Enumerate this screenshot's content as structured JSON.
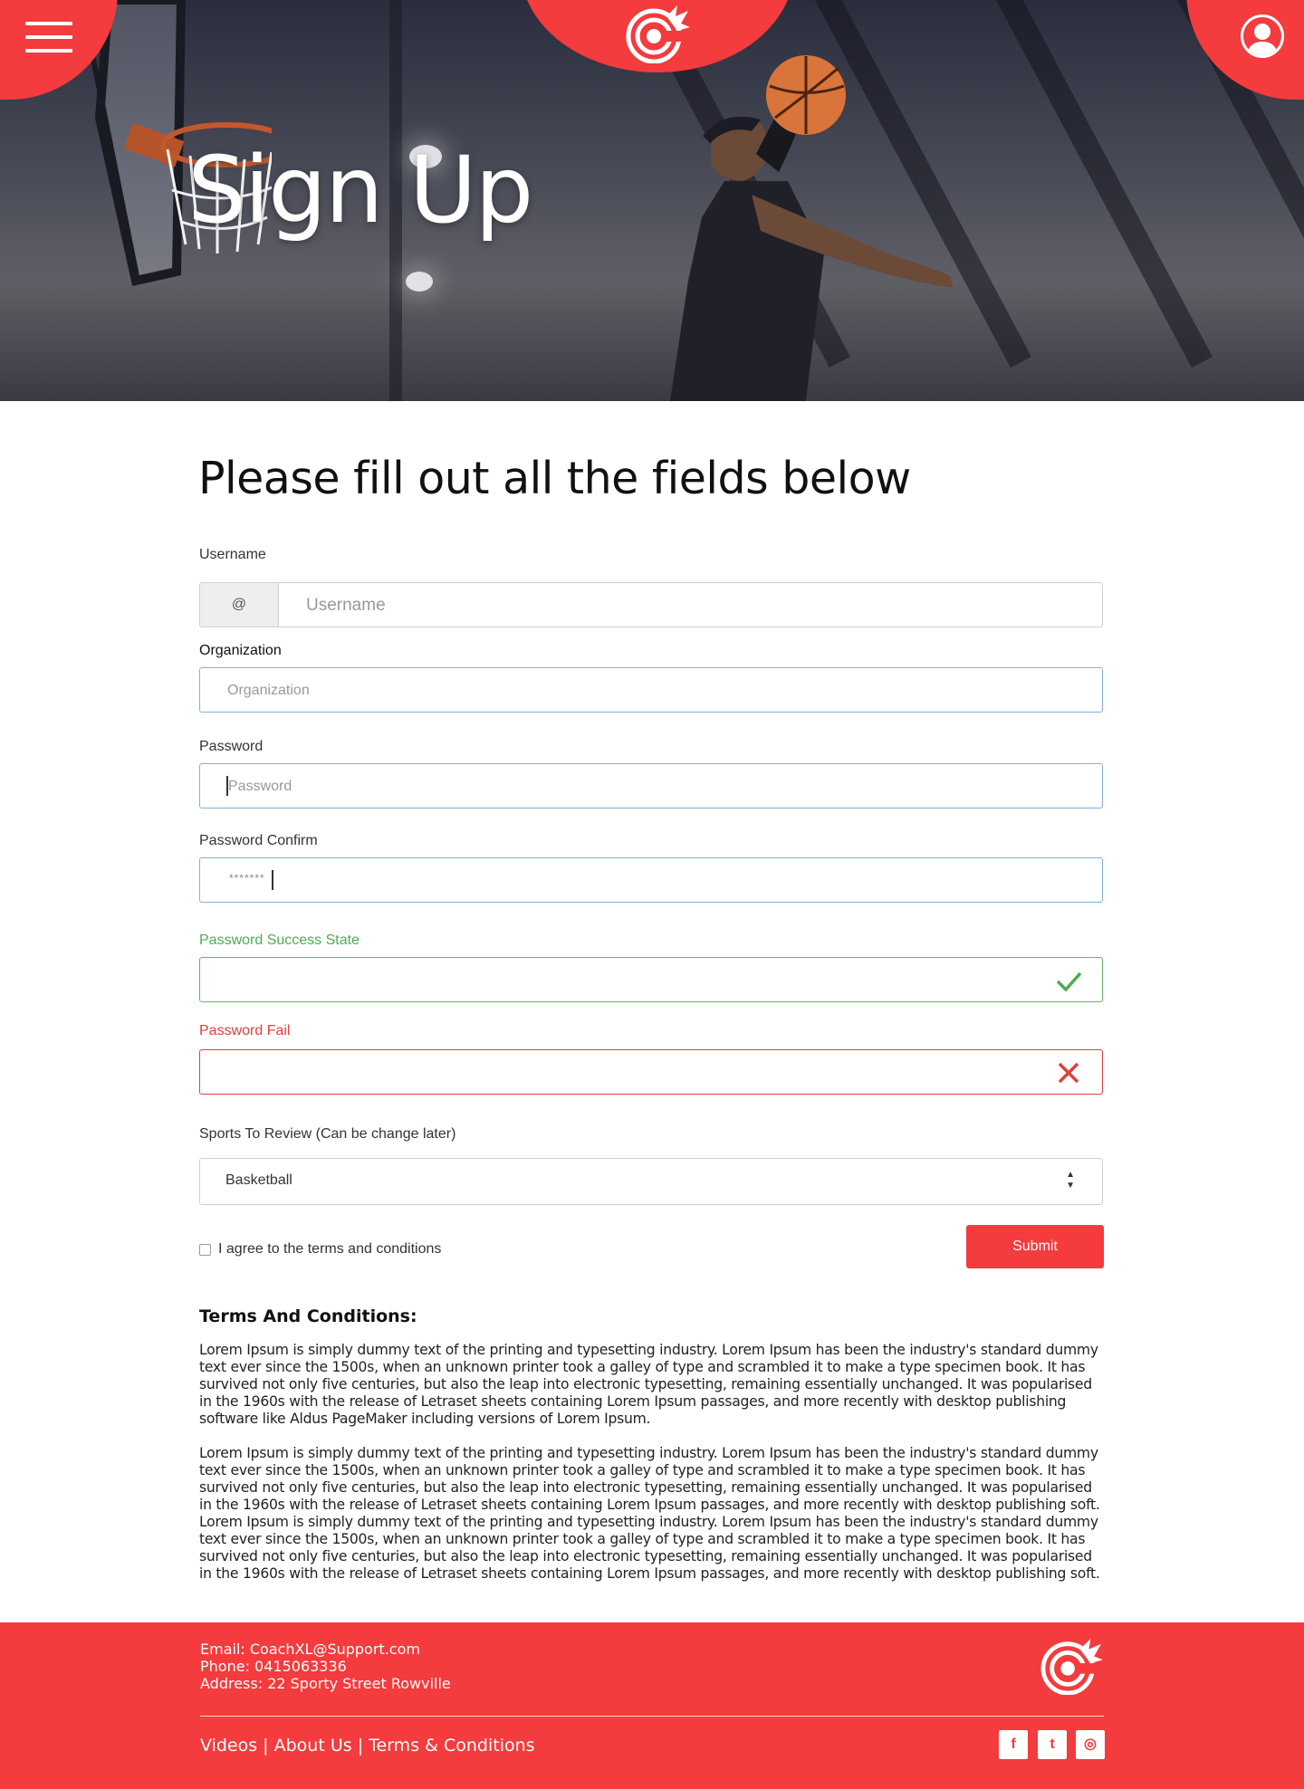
{
  "hero": {
    "title": "Sign Up"
  },
  "form": {
    "heading": "Please fill out all the fields below",
    "username": {
      "label": "Username",
      "addon": "@",
      "placeholder": "Username"
    },
    "organization": {
      "label": "Organization",
      "placeholder": "Organization"
    },
    "password": {
      "label": "Password",
      "placeholder": "Password"
    },
    "password_confirm": {
      "label": "Password Confirm",
      "value": "*******"
    },
    "password_success": {
      "label": "Password Success State"
    },
    "password_fail": {
      "label": "Password Fail"
    },
    "sports": {
      "label": "Sports To Review (Can be change later)",
      "selected": "Basketball"
    },
    "agree_label": "I agree to the terms and conditions",
    "submit_label": "Submit"
  },
  "terms": {
    "title": "Terms And Conditions:",
    "paragraph1": "Lorem Ipsum is simply dummy text of the printing and typesetting industry. Lorem Ipsum has been the industry's standard dummy text ever since the 1500s, when an unknown printer took a galley of type and scrambled it to make a type specimen book. It has survived not only five centuries, but also the leap into electronic typesetting, remaining essentially unchanged. It was popularised in the 1960s with the release of Letraset sheets containing Lorem Ipsum passages, and more recently with desktop publishing software like Aldus PageMaker including versions of Lorem Ipsum.",
    "paragraph2": "Lorem Ipsum is simply dummy text of the printing and typesetting industry. Lorem Ipsum has been the industry's standard dummy text ever since the 1500s, when an unknown printer took a galley of type and scrambled it to make a type specimen book. It has survived not only five centuries, but also the leap into electronic typesetting, remaining essentially unchanged. It was popularised in the 1960s with the release of Letraset sheets containing Lorem Ipsum passages, and more recently with desktop publishing soft.  Lorem Ipsum is simply dummy text of the printing and typesetting industry. Lorem Ipsum has been the industry's standard dummy text ever since the 1500s, when an unknown printer took a galley of type and scrambled it to make a type specimen book. It has survived not only five centuries, but also the leap into electronic typesetting, remaining essentially unchanged. It was popularised in the 1960s with the release of Letraset sheets containing Lorem Ipsum passages, and more recently with desktop publishing soft."
  },
  "footer": {
    "email": "Email: CoachXL@Support.com",
    "phone": "Phone: 0415063336",
    "address": "Address: 22 Sporty Street Rowville",
    "links": [
      "Videos",
      "About Us",
      "Terms & Conditions"
    ],
    "separator": " | ",
    "social": [
      {
        "icon": "facebook-icon",
        "glyph": "f"
      },
      {
        "icon": "twitter-icon",
        "glyph": "t"
      },
      {
        "icon": "instagram-icon",
        "glyph": "◎"
      }
    ]
  },
  "colors": {
    "brand_red": "#f43b3d",
    "success_green": "#4cae4c",
    "error_red": "#e0403c",
    "focus_blue": "#7fb1dc"
  }
}
